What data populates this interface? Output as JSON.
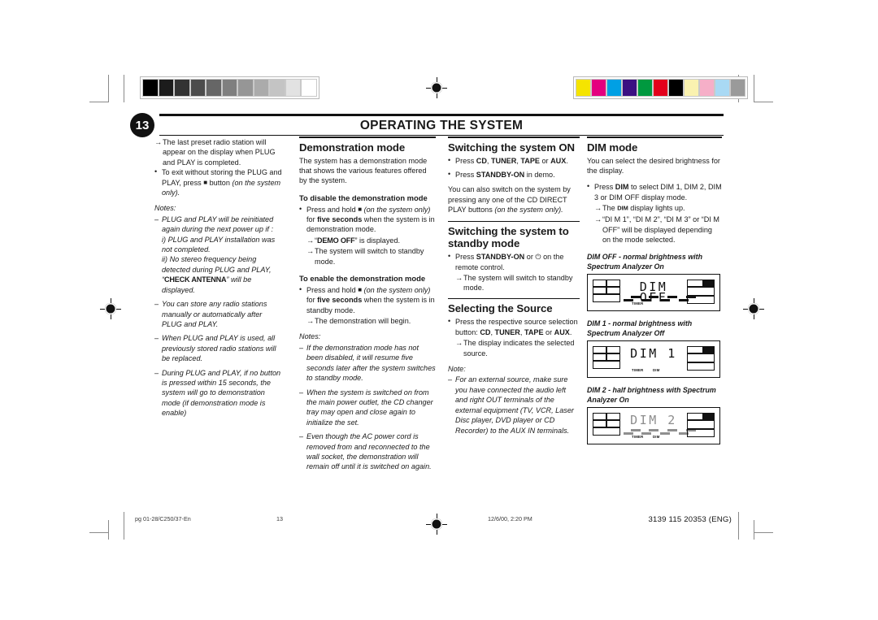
{
  "page": {
    "number": "13",
    "title": "OPERATING THE SYSTEM"
  },
  "prepress": {
    "gray_bar": [
      "#000000",
      "#1c1c1c",
      "#333333",
      "#4c4c4c",
      "#666666",
      "#7f7f7f",
      "#969696",
      "#ababab",
      "#c4c4c4",
      "#e2e2e2",
      "#ffffff"
    ],
    "color_bar": [
      "#f5e400",
      "#e4007f",
      "#00a0e4",
      "#3b1082",
      "#00993f",
      "#e3001b",
      "#000000",
      "#faf2b0",
      "#f6afc8",
      "#a9d9f4",
      "#9a9a9a"
    ]
  },
  "col1": {
    "arrow1": "The last preset radio station will appear on the display when PLUG and PLAY is completed.",
    "bullet1_a": "To exit without storing the PLUG and PLAY, press",
    "bullet1_b": "button",
    "bullet1_c": "(on the system only).",
    "notes_label": "Notes:",
    "note1": "PLUG and PLAY will be reinitiated again during the next power up if :",
    "note1_i": "i) PLUG and PLAY installation was not completed.",
    "note1_ii_a": "ii) No stereo frequency being detected during PLUG and PLAY, “",
    "note1_ii_b": "CHECK ANTENNA",
    "note1_ii_c": "” will be displayed.",
    "note2": "You can store any radio stations manually or automatically after PLUG and PLAY.",
    "note3": "When PLUG and PLAY is used, all previously stored radio stations will be replaced.",
    "note4": "During PLUG and PLAY, if no button is pressed within 15 seconds, the system will go to demonstration mode (if demonstration mode is enable)"
  },
  "col2": {
    "heading": "Demonstration mode",
    "intro": "The system has a demonstration mode that shows the various features offered by the system.",
    "sub_disable": "To disable the demonstration mode",
    "disable_a": "Press and hold",
    "disable_b": "(on the system only)",
    "disable_c": "for",
    "disable_bold": "five seconds",
    "disable_d": "when the system is in demonstration mode.",
    "disable_arrow1_a": "“",
    "disable_arrow1_b": "DEMO OFF",
    "disable_arrow1_c": "” is displayed.",
    "disable_arrow2": "The system will switch to standby mode.",
    "sub_enable": "To enable the demonstration mode",
    "enable_a": "Press and hold",
    "enable_b": "(on the system only)",
    "enable_c": "for",
    "enable_bold": "five seconds",
    "enable_d": "when the system is in standby mode.",
    "enable_arrow": "The demonstration will begin.",
    "notes_label": "Notes:",
    "note1": "If the demonstration mode has not been disabled, it will resume five seconds later after the system switches to standby mode.",
    "note2": "When the system is switched on from the main power outlet, the CD changer tray may open and close again to initialize the set.",
    "note3": "Even though the AC power cord is removed from and reconnected to the wall socket, the demonstration will remain off until it is switched on again."
  },
  "col3": {
    "heading_on": "Switching the system ON",
    "on_b1_a": "Press",
    "on_b1_cd": "CD",
    "on_b1_tuner": "TUNER",
    "on_b1_tape": "TAPE",
    "on_b1_or": "or",
    "on_b1_aux": "AUX",
    "on_b2_a": "Press",
    "on_b2_bold": "STANDBY-ON",
    "on_b2_b": "in demo.",
    "on_para": "You can also switch on the system by pressing any one of the CD DIRECT PLAY buttons",
    "on_para_it": "(on the system only).",
    "heading_standby": "Switching the system to standby mode",
    "standby_b1_a": "Press",
    "standby_b1_bold": "STANDBY-ON",
    "standby_b1_b": "or",
    "standby_b1_c": "on the remote control.",
    "standby_arrow": "The system will switch to standby mode.",
    "heading_source": "Selecting the Source",
    "source_b1_a": "Press the respective source selection button:",
    "source_cd": "CD",
    "source_tuner": "TUNER",
    "source_tape": "TAPE",
    "source_or": "or",
    "source_aux": "AUX",
    "source_arrow": "The display indicates the selected source.",
    "note_label": "Note:",
    "note1": "For an external source, make sure you have connected the audio left and right OUT terminals of the external equipment (TV, VCR, Laser Disc player, DVD player or CD Recorder) to the AUX IN terminals."
  },
  "col4": {
    "heading": "DIM mode",
    "intro": "You can select the desired brightness for the display.",
    "b1_a": "Press",
    "b1_bold": "DIM",
    "b1_b": "to select DIM 1, DIM 2, DIM 3 or DIM OFF display mode.",
    "arrow1_a": "The",
    "arrow1_dim": "DIM",
    "arrow1_b": "display lights up.",
    "arrow2": "“DI M 1”, “DI M 2”, “DI M 3” or “DI M OFF” will be displayed depending on the mode selected.",
    "lcd1_caption": "DIM OFF - normal brightness with Spectrum Analyzer On",
    "lcd1_text": "DIM OFF",
    "lcd2_caption": "DIM 1 - normal brightness with Spectrum Analyzer Off",
    "lcd2_text": "DIM 1",
    "lcd3_caption": "DIM 2 - half brightness with Spectrum Analyzer On",
    "lcd3_text": "DIM 2",
    "lcd_label_timer": "TIMER",
    "lcd_label_dim": "DIM"
  },
  "footer": {
    "left": "pg 01-28/C250/37-En",
    "page": "13",
    "date": "12/6/00, 2:20 PM",
    "right": "3139 115 20353 (ENG)"
  }
}
